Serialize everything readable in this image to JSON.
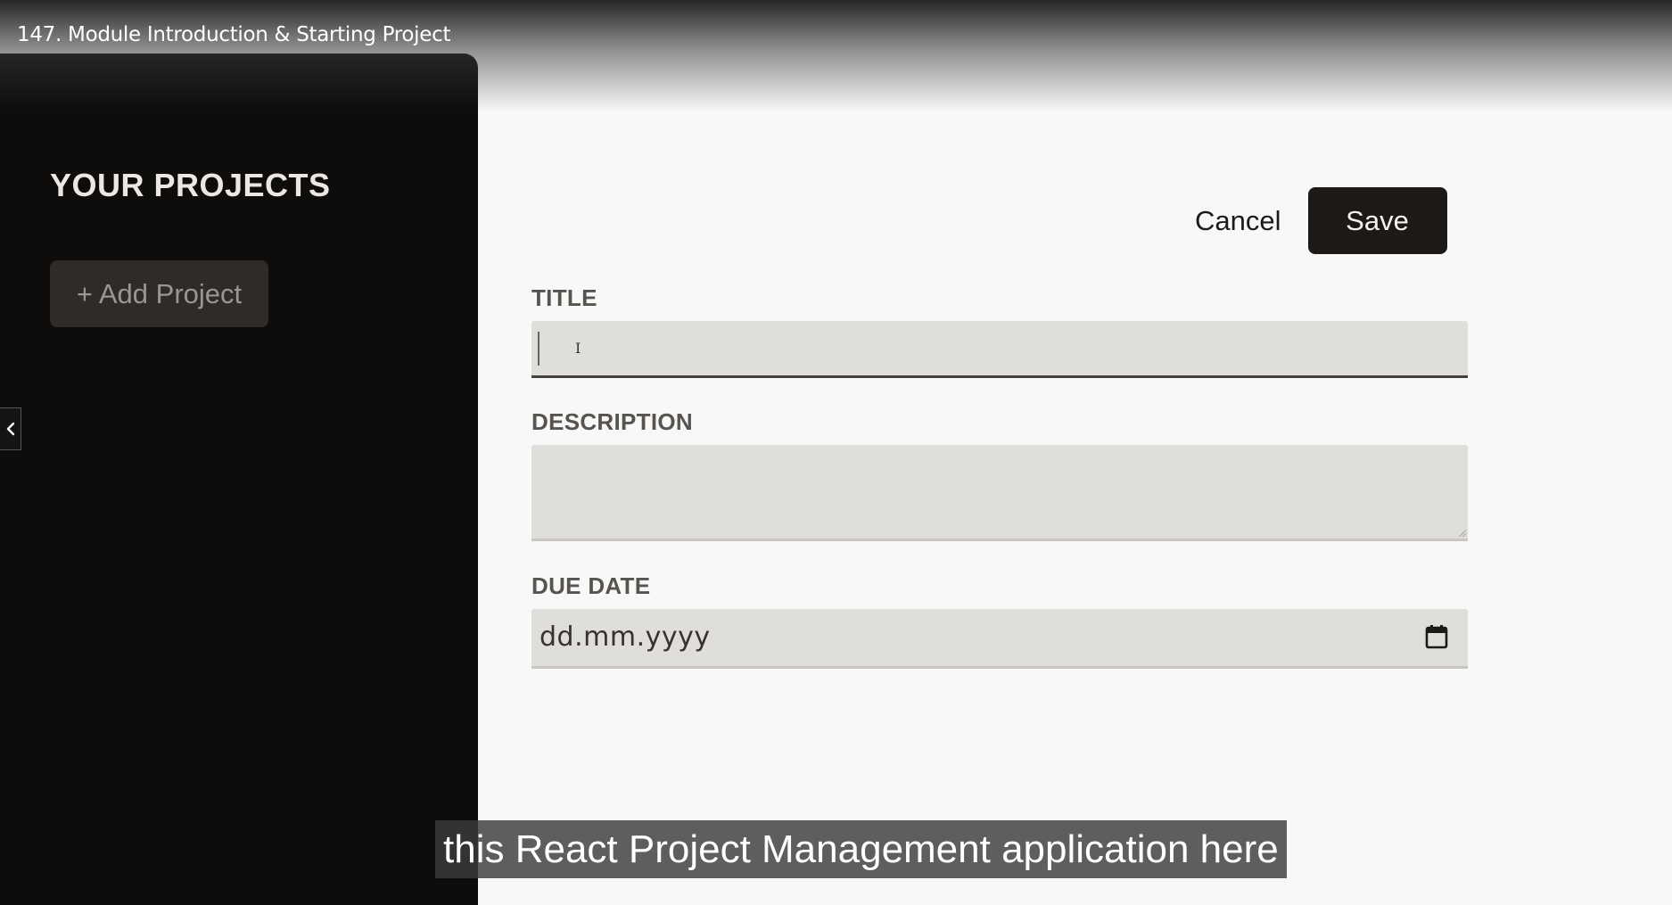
{
  "video": {
    "title": "147. Module Introduction & Starting Project"
  },
  "sidebar": {
    "heading": "YOUR PROJECTS",
    "add_project_label": "+ Add Project"
  },
  "form": {
    "cancel_label": "Cancel",
    "save_label": "Save",
    "title_label": "TITLE",
    "title_value": "",
    "description_label": "DESCRIPTION",
    "description_value": "",
    "due_date_label": "DUE DATE",
    "due_date_placeholder": "dd.mm.yyyy"
  },
  "caption": {
    "text": "this React Project Management application here"
  },
  "icons": {
    "collapse": "chevron-left-icon",
    "calendar": "calendar-icon",
    "cursor": "text-cursor-icon"
  },
  "colors": {
    "sidebar_bg": "#0e0d0c",
    "save_bg": "#1c1917",
    "input_bg": "#e0dedb",
    "label_color": "#57534e",
    "page_bg": "#f8f8f8"
  }
}
